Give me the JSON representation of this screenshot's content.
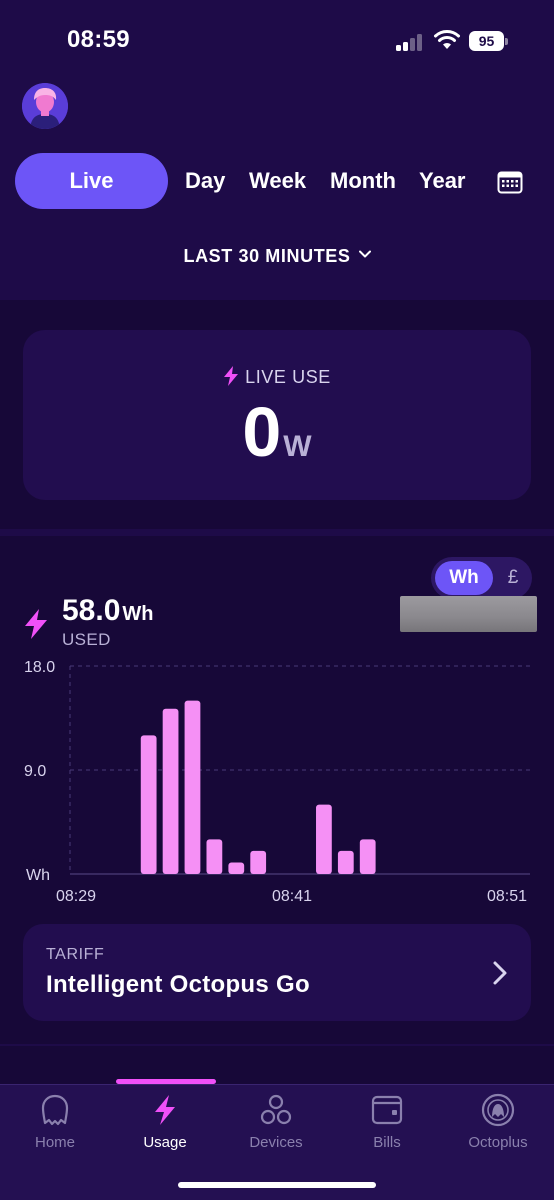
{
  "status_bar": {
    "time": "08:59",
    "battery": "95"
  },
  "tabs": [
    {
      "label": "Live",
      "active": true
    },
    {
      "label": "Day",
      "active": false
    },
    {
      "label": "Week",
      "active": false
    },
    {
      "label": "Month",
      "active": false
    },
    {
      "label": "Year",
      "active": false
    }
  ],
  "range": {
    "label": "LAST 30 MINUTES"
  },
  "live_use": {
    "label": "LIVE USE",
    "value": "0",
    "unit": "W"
  },
  "unit_toggle": {
    "wh": "Wh",
    "gbp": "£",
    "selected": "Wh"
  },
  "usage_summary": {
    "value": "58.0",
    "unit": "Wh",
    "label": "USED"
  },
  "chart_data": {
    "type": "bar",
    "ylabel": "Wh",
    "ylim": [
      0,
      18
    ],
    "yticks": [
      {
        "value": 18,
        "label": "18.0"
      },
      {
        "value": 9,
        "label": "9.0"
      }
    ],
    "xtick_labels": [
      "08:29",
      "08:41",
      "08:51"
    ],
    "values": [
      0,
      0,
      0,
      12.0,
      14.3,
      15.0,
      3.0,
      1.0,
      2.0,
      0,
      0,
      6.0,
      2.0,
      3.0,
      0,
      0,
      0,
      0,
      0,
      0,
      0
    ],
    "bar_color": "#f590f5",
    "grid": true
  },
  "tariff": {
    "label": "TARIFF",
    "name": "Intelligent Octopus Go"
  },
  "nav": [
    {
      "label": "Home",
      "icon": "octopus-icon",
      "active": false
    },
    {
      "label": "Usage",
      "icon": "lightning-icon",
      "active": true
    },
    {
      "label": "Devices",
      "icon": "devices-icon",
      "active": false
    },
    {
      "label": "Bills",
      "icon": "wallet-icon",
      "active": false
    },
    {
      "label": "Octoplus",
      "icon": "octoplus-icon",
      "active": false
    }
  ],
  "colors": {
    "background": "#1e0b48",
    "accent": "#6d55f7",
    "bars": "#f590f5",
    "highlight": "#f050f8"
  }
}
